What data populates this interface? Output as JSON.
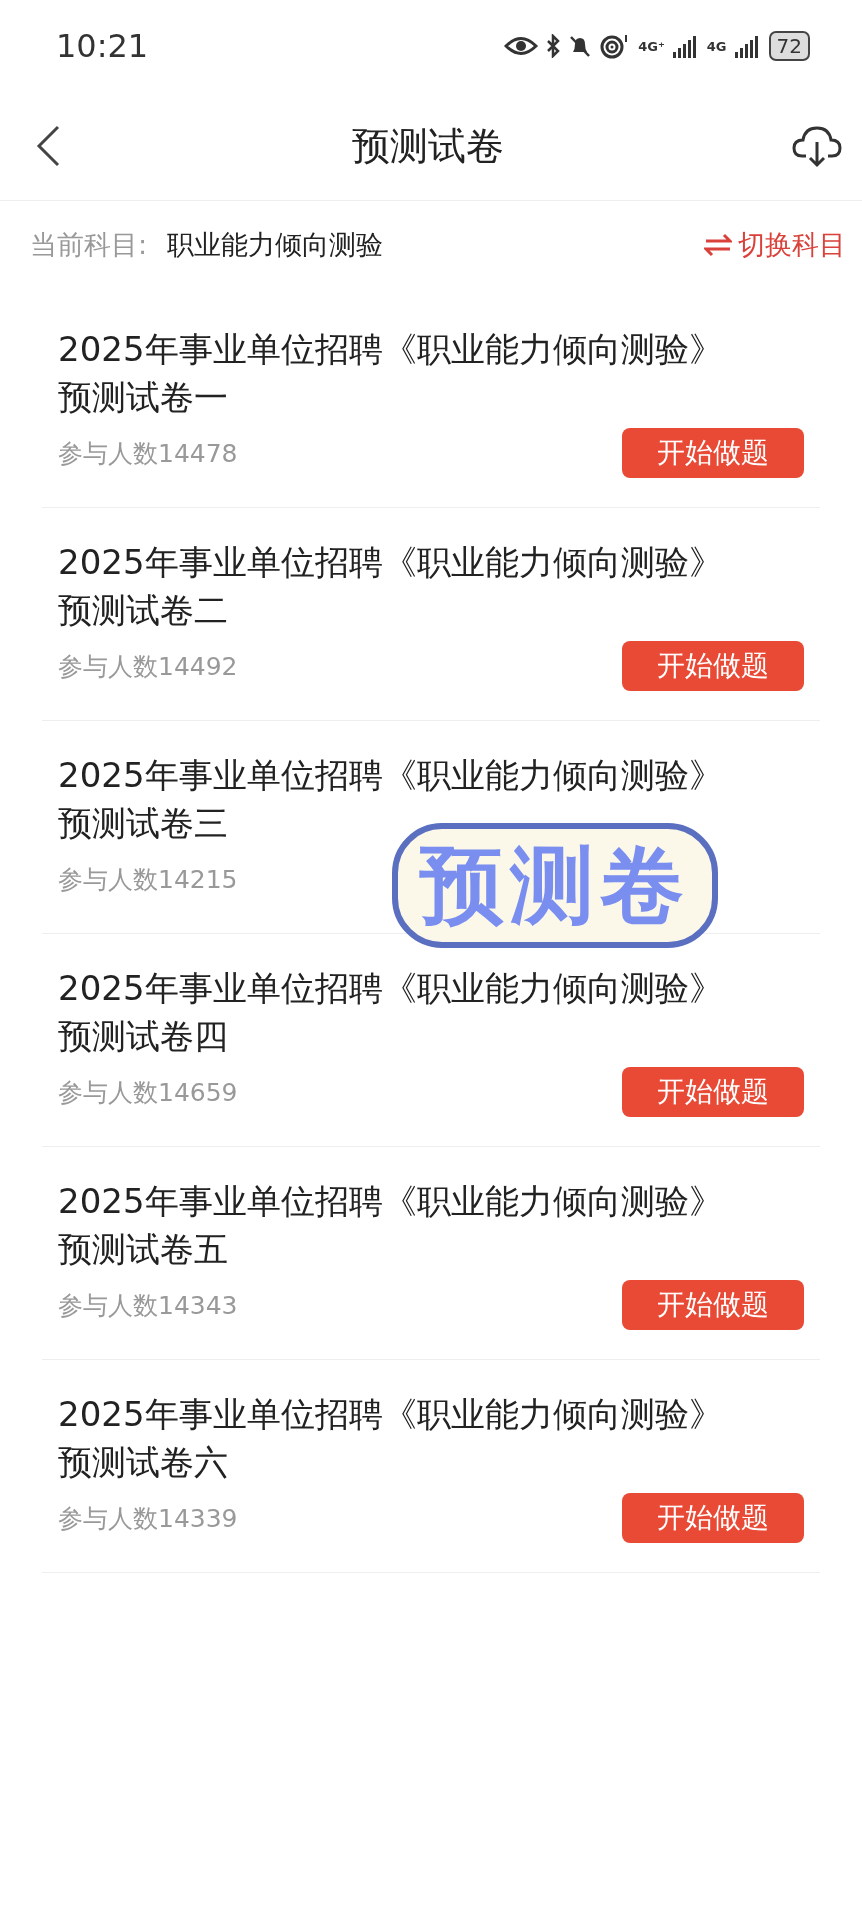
{
  "status_bar": {
    "time": "10:21",
    "network_1": "4G⁺",
    "network_2": "4G",
    "battery": "72"
  },
  "header": {
    "title": "预测试卷"
  },
  "subject": {
    "label": "当前科目:",
    "value": "职业能力倾向测验",
    "switch": "切换科目"
  },
  "papers": [
    {
      "title_line_1": "2025年事业单位招聘《职业能力倾向测验》",
      "title_line_2": "预测试卷一",
      "count": "参与人数14478",
      "button": "开始做题"
    },
    {
      "title_line_1": "2025年事业单位招聘《职业能力倾向测验》",
      "title_line_2": "预测试卷二",
      "count": "参与人数14492",
      "button": "开始做题"
    },
    {
      "title_line_1": "2025年事业单位招聘《职业能力倾向测验》",
      "title_line_2": "预测试卷三",
      "count": "参与人数14215"
    },
    {
      "title_line_1": "2025年事业单位招聘《职业能力倾向测验》",
      "title_line_2": "预测试卷四",
      "count": "参与人数14659",
      "button": "开始做题"
    },
    {
      "title_line_1": "2025年事业单位招聘《职业能力倾向测验》",
      "title_line_2": "预测试卷五",
      "count": "参与人数14343",
      "button": "开始做题"
    },
    {
      "title_line_1": "2025年事业单位招聘《职业能力倾向测验》",
      "title_line_2": "预测试卷六",
      "count": "参与人数14339",
      "button": "开始做题"
    }
  ],
  "sticker": {
    "text": "预测卷"
  }
}
